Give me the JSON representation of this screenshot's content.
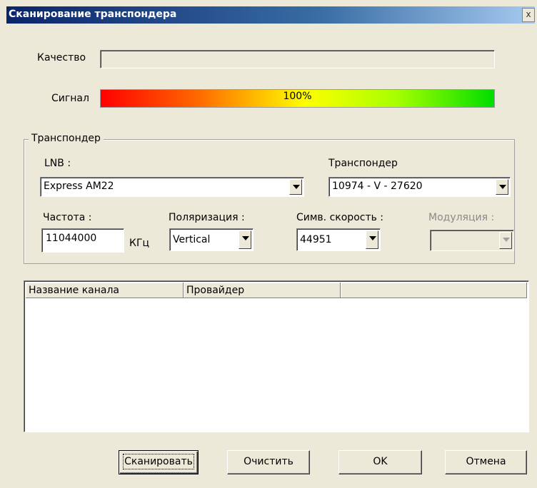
{
  "window": {
    "title": "Сканирование транспондера",
    "close_label": "x"
  },
  "quality": {
    "label": "Качество",
    "value": 0
  },
  "signal": {
    "label": "Сигнал",
    "value_text": "100%",
    "value": 1.0
  },
  "transponder_group": {
    "legend": "Транспондер",
    "lnb_label": "LNB :",
    "lnb_value": "Express AM22",
    "transponder_label": "Транспондер",
    "transponder_value": "10974 - V - 27620",
    "frequency_label": "Частота :",
    "frequency_value": "11044000",
    "frequency_unit": "КГц",
    "polarization_label": "Поляризация :",
    "polarization_value": "Vertical",
    "symrate_label": "Симв. скорость :",
    "symrate_value": "44951",
    "modulation_label": "Модуляция :",
    "modulation_value": ""
  },
  "channel_list": {
    "columns": [
      "Название канала",
      "Провайдер",
      ""
    ],
    "rows": []
  },
  "buttons": {
    "scan": "Сканировать",
    "clear": "Очистить",
    "ok": "OK",
    "cancel": "Отмена"
  },
  "colors": {
    "signal_start": "#ff0000",
    "signal_mid": "#ffff00",
    "signal_end": "#00dd00",
    "titlebar": "#0a246a"
  }
}
